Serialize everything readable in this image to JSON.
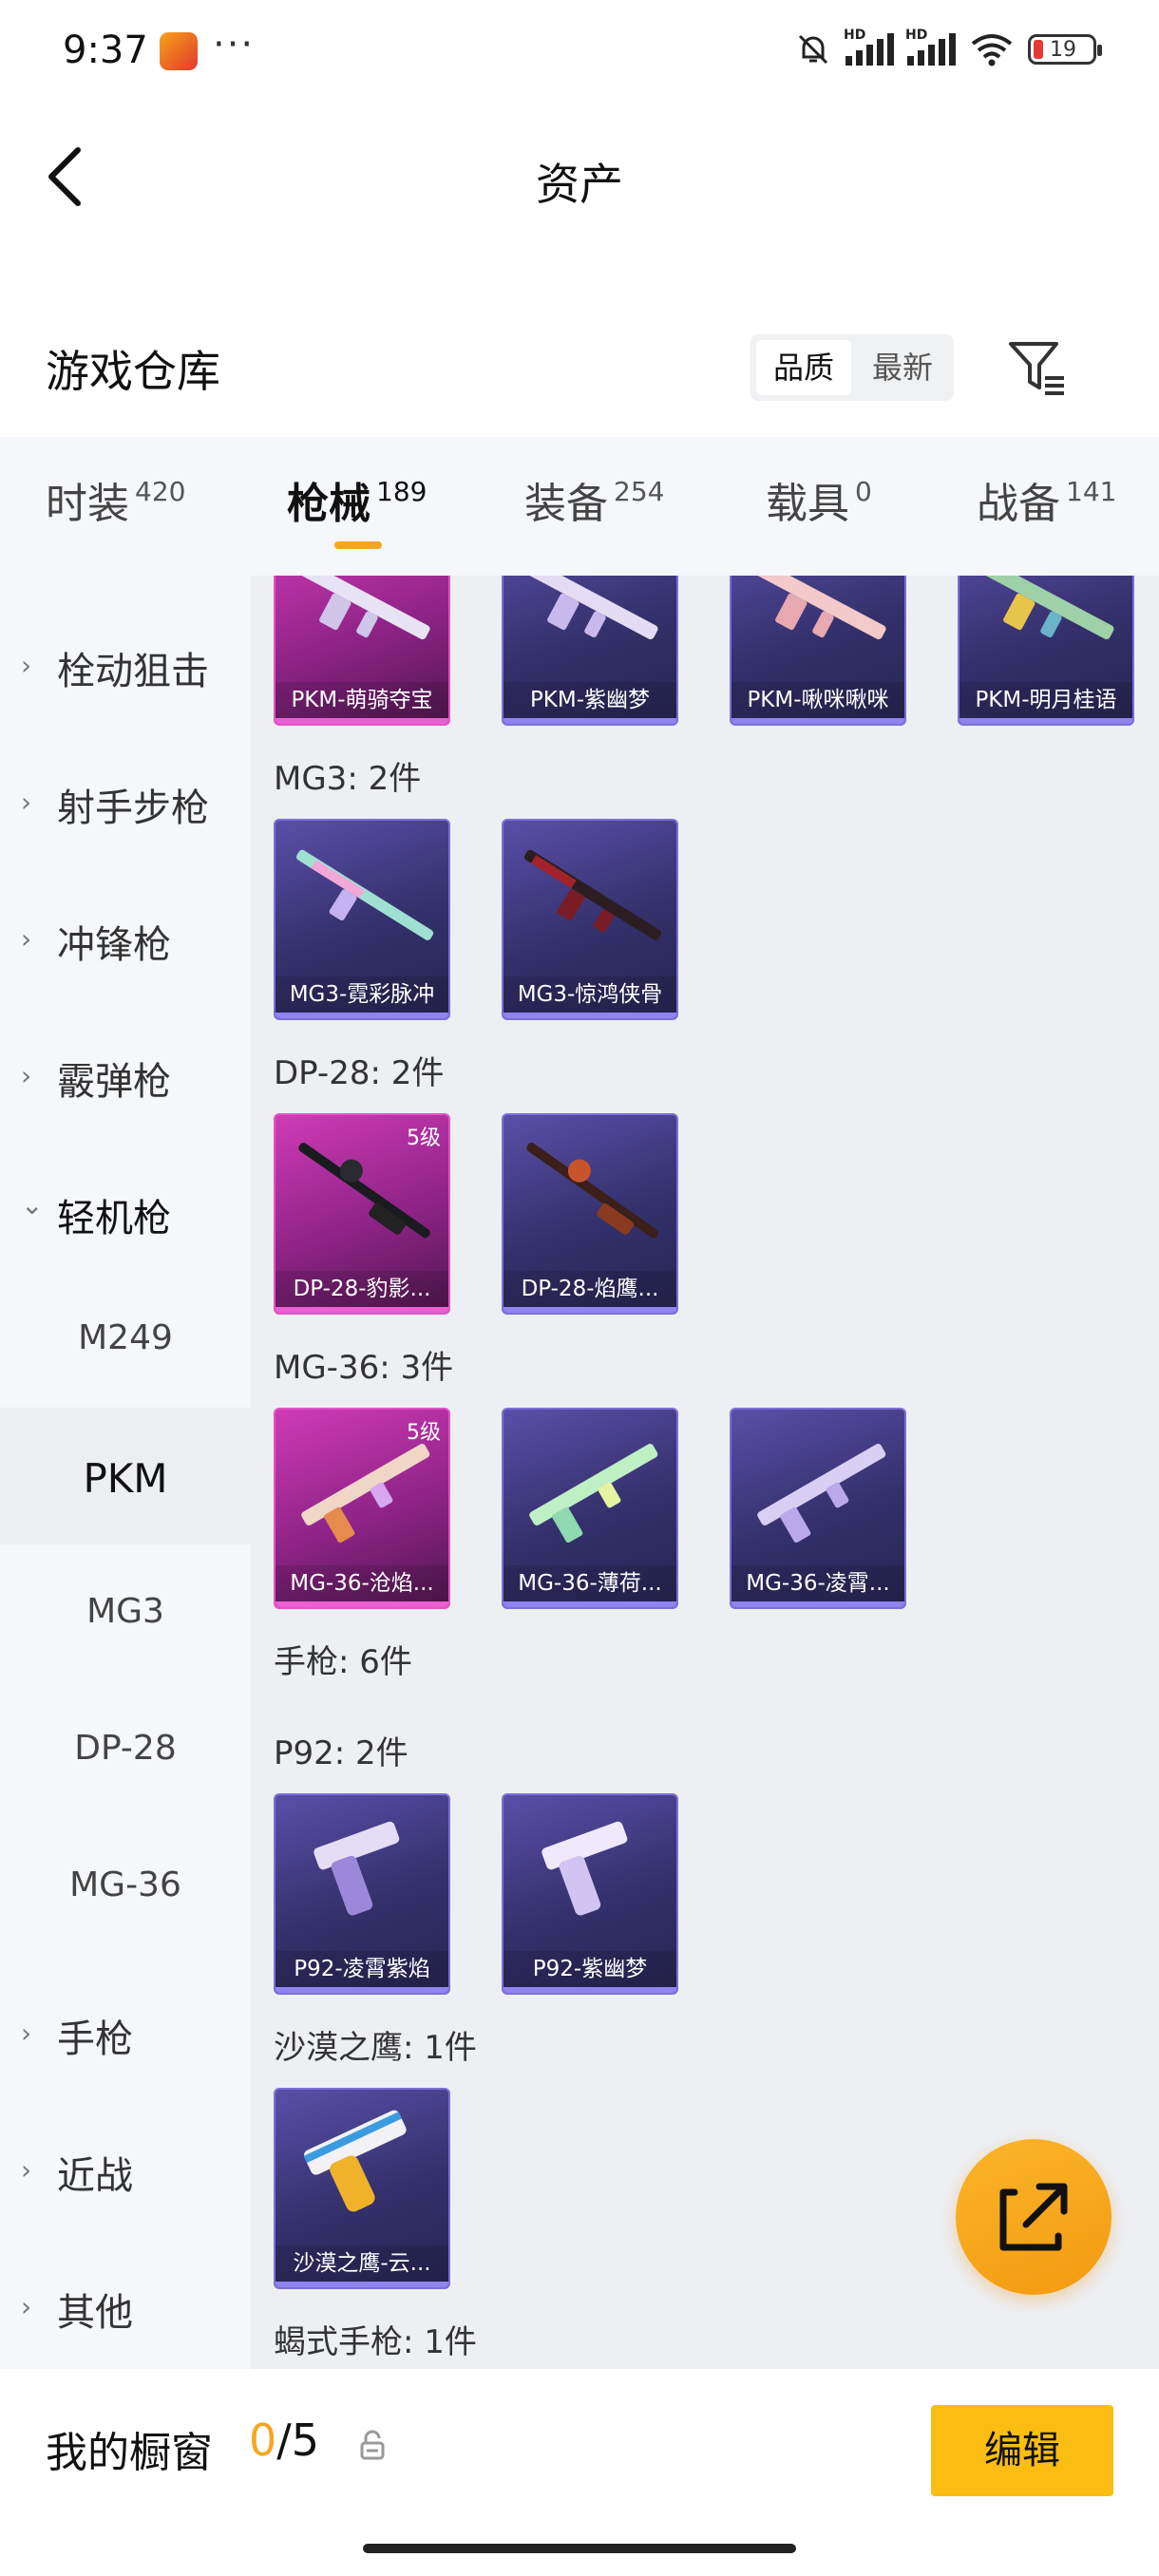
{
  "status_bar": {
    "time": "9:37",
    "more": "···",
    "battery": "19",
    "signal_hd_1": "HD",
    "signal_hd_2": "HD"
  },
  "header": {
    "title": "资产"
  },
  "warehouse": {
    "title": "游戏仓库",
    "sort_options": [
      "品质",
      "最新"
    ]
  },
  "tabs": [
    {
      "label": "时装",
      "count": "420"
    },
    {
      "label": "枪械",
      "count": "189"
    },
    {
      "label": "装备",
      "count": "254"
    },
    {
      "label": "载具",
      "count": "0"
    },
    {
      "label": "战备",
      "count": "141"
    }
  ],
  "sidebar": {
    "categories": [
      "栓动狙击",
      "射手步枪",
      "冲锋枪",
      "霰弹枪",
      "轻机枪",
      "手枪",
      "近战",
      "其他"
    ],
    "subitems": [
      "M249",
      "PKM",
      "MG3",
      "DP-28",
      "MG-36"
    ]
  },
  "content": {
    "groups": [
      {
        "title": "",
        "items": [
          "PKM-萌骑夺宝",
          "PKM-紫幽梦",
          "PKM-啾咪啾咪",
          "PKM-明月桂语"
        ]
      },
      {
        "title": "MG3: 2件",
        "items": [
          "MG3-霓彩脉冲",
          "MG3-惊鸿侠骨"
        ]
      },
      {
        "title": "DP-28: 2件",
        "items": [
          "DP-28-豹影...",
          "DP-28-焰鹰..."
        ],
        "levels": [
          "5级",
          ""
        ]
      },
      {
        "title": "MG-36: 3件",
        "items": [
          "MG-36-沧焰...",
          "MG-36-薄荷...",
          "MG-36-凌霄..."
        ],
        "levels": [
          "5级",
          "",
          ""
        ]
      },
      {
        "title": "手枪: 6件"
      },
      {
        "title": "P92: 2件",
        "items": [
          "P92-凌霄紫焰",
          "P92-紫幽梦"
        ]
      },
      {
        "title": "沙漠之鹰: 1件",
        "items": [
          "沙漠之鹰-云..."
        ]
      },
      {
        "title": "蝎式手枪: 1件"
      }
    ]
  },
  "bottom": {
    "showcase_label": "我的橱窗",
    "current": "0",
    "separator": "/",
    "total": "5",
    "edit_label": "编辑"
  },
  "colors": {
    "accent": "#f5a623",
    "edit_button": "#fbbd12",
    "rarity_purple": "#7c70d6",
    "rarity_pink": "#e055c6"
  },
  "icons": [
    "back-arrow-icon",
    "filter-icon",
    "chevron-right-icon",
    "chevron-down-icon",
    "lock-icon",
    "share-icon"
  ]
}
